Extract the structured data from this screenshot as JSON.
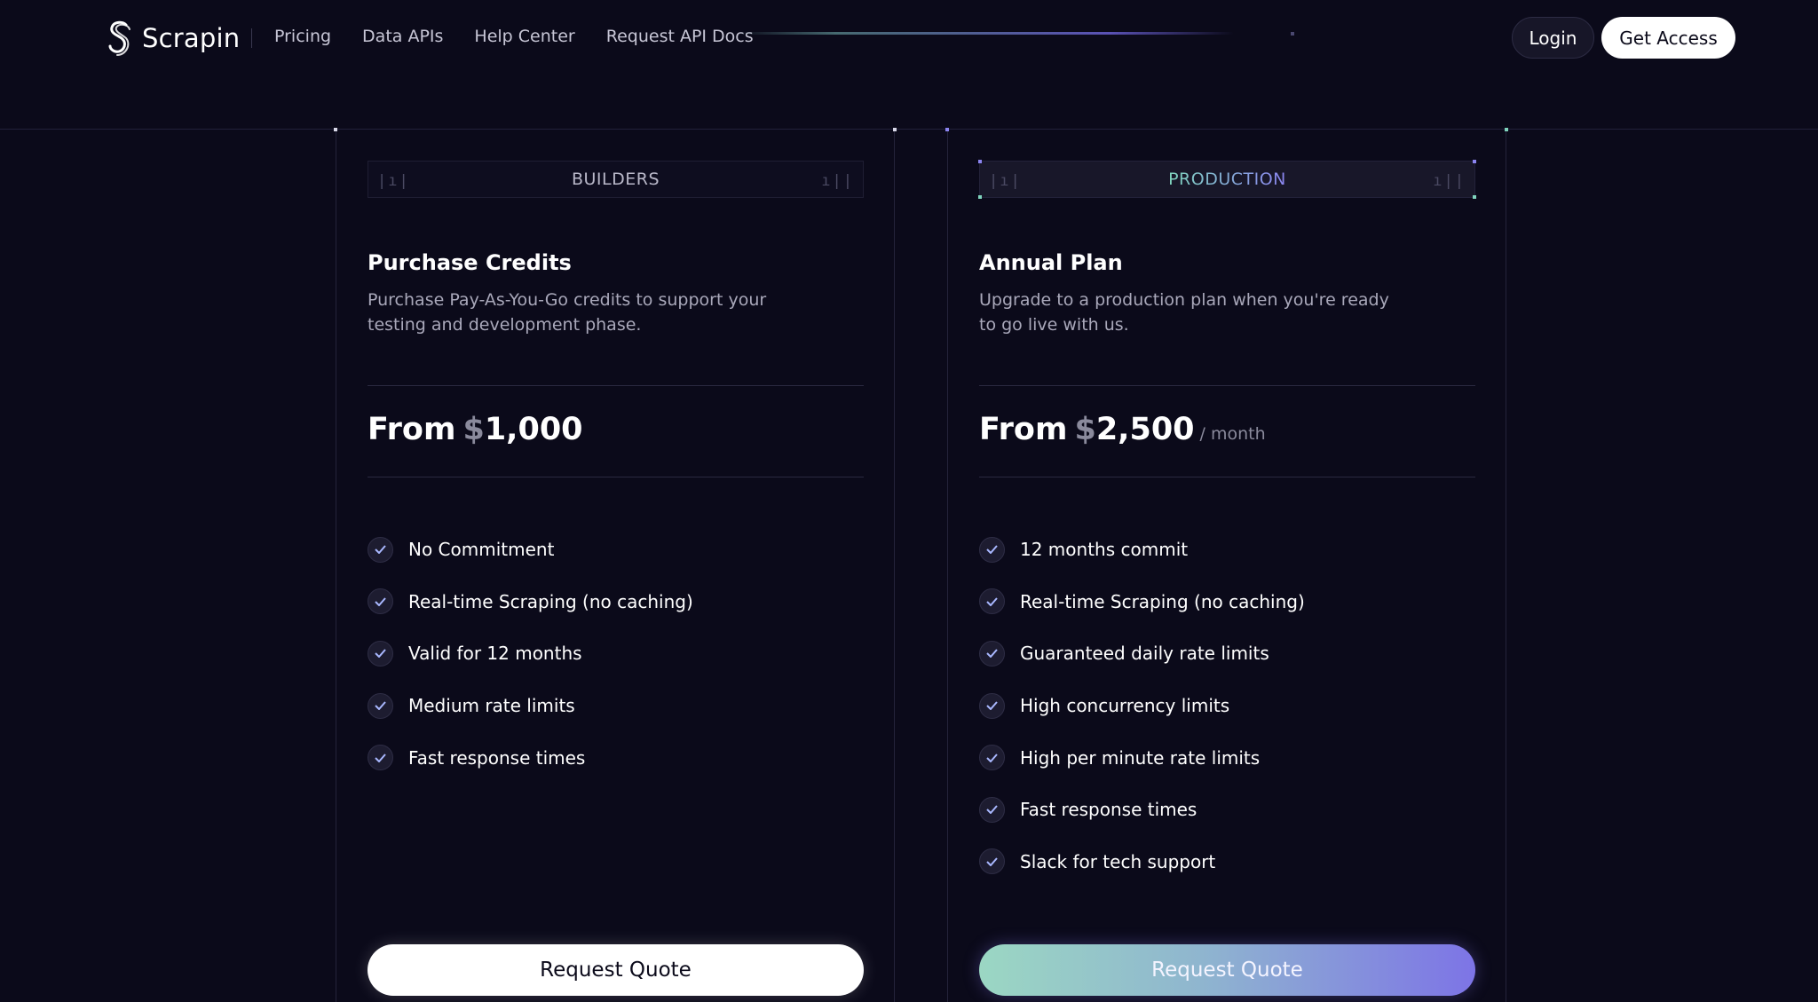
{
  "brand": {
    "name": "Scrapin"
  },
  "nav": {
    "links": [
      "Pricing",
      "Data APIs",
      "Help Center",
      "Request API Docs"
    ],
    "login_label": "Login",
    "access_label": "Get Access"
  },
  "plans": [
    {
      "tier": "BUILDERS",
      "title": "Purchase Credits",
      "description": "Purchase Pay-As-You-Go credits to support your testing and development phase.",
      "price_prefix": "From",
      "currency": "$",
      "amount": "1,000",
      "period": "",
      "features": [
        "No Commitment",
        "Real-time Scraping (no caching)",
        "Valid for 12 months",
        "Medium rate limits",
        "Fast response times"
      ],
      "cta": "Request Quote"
    },
    {
      "tier": "PRODUCTION",
      "title": "Annual Plan",
      "description": "Upgrade to a production plan when you're ready to go live with us.",
      "price_prefix": "From",
      "currency": "$",
      "amount": "2,500",
      "period": "/ month",
      "features": [
        "12 months commit",
        "Real-time Scraping (no caching)",
        "Guaranteed daily rate limits",
        "High concurrency limits",
        "High per minute rate limits",
        "Fast response times",
        "Slack for tech support"
      ],
      "cta": "Request Quote"
    }
  ],
  "colors": {
    "background": "#0b0a1a",
    "accent_teal": "#7fd4bd",
    "accent_purple": "#8b84f0"
  },
  "icons": {
    "logo": "scrapin-s-logo-icon",
    "feature": "check-icon"
  }
}
